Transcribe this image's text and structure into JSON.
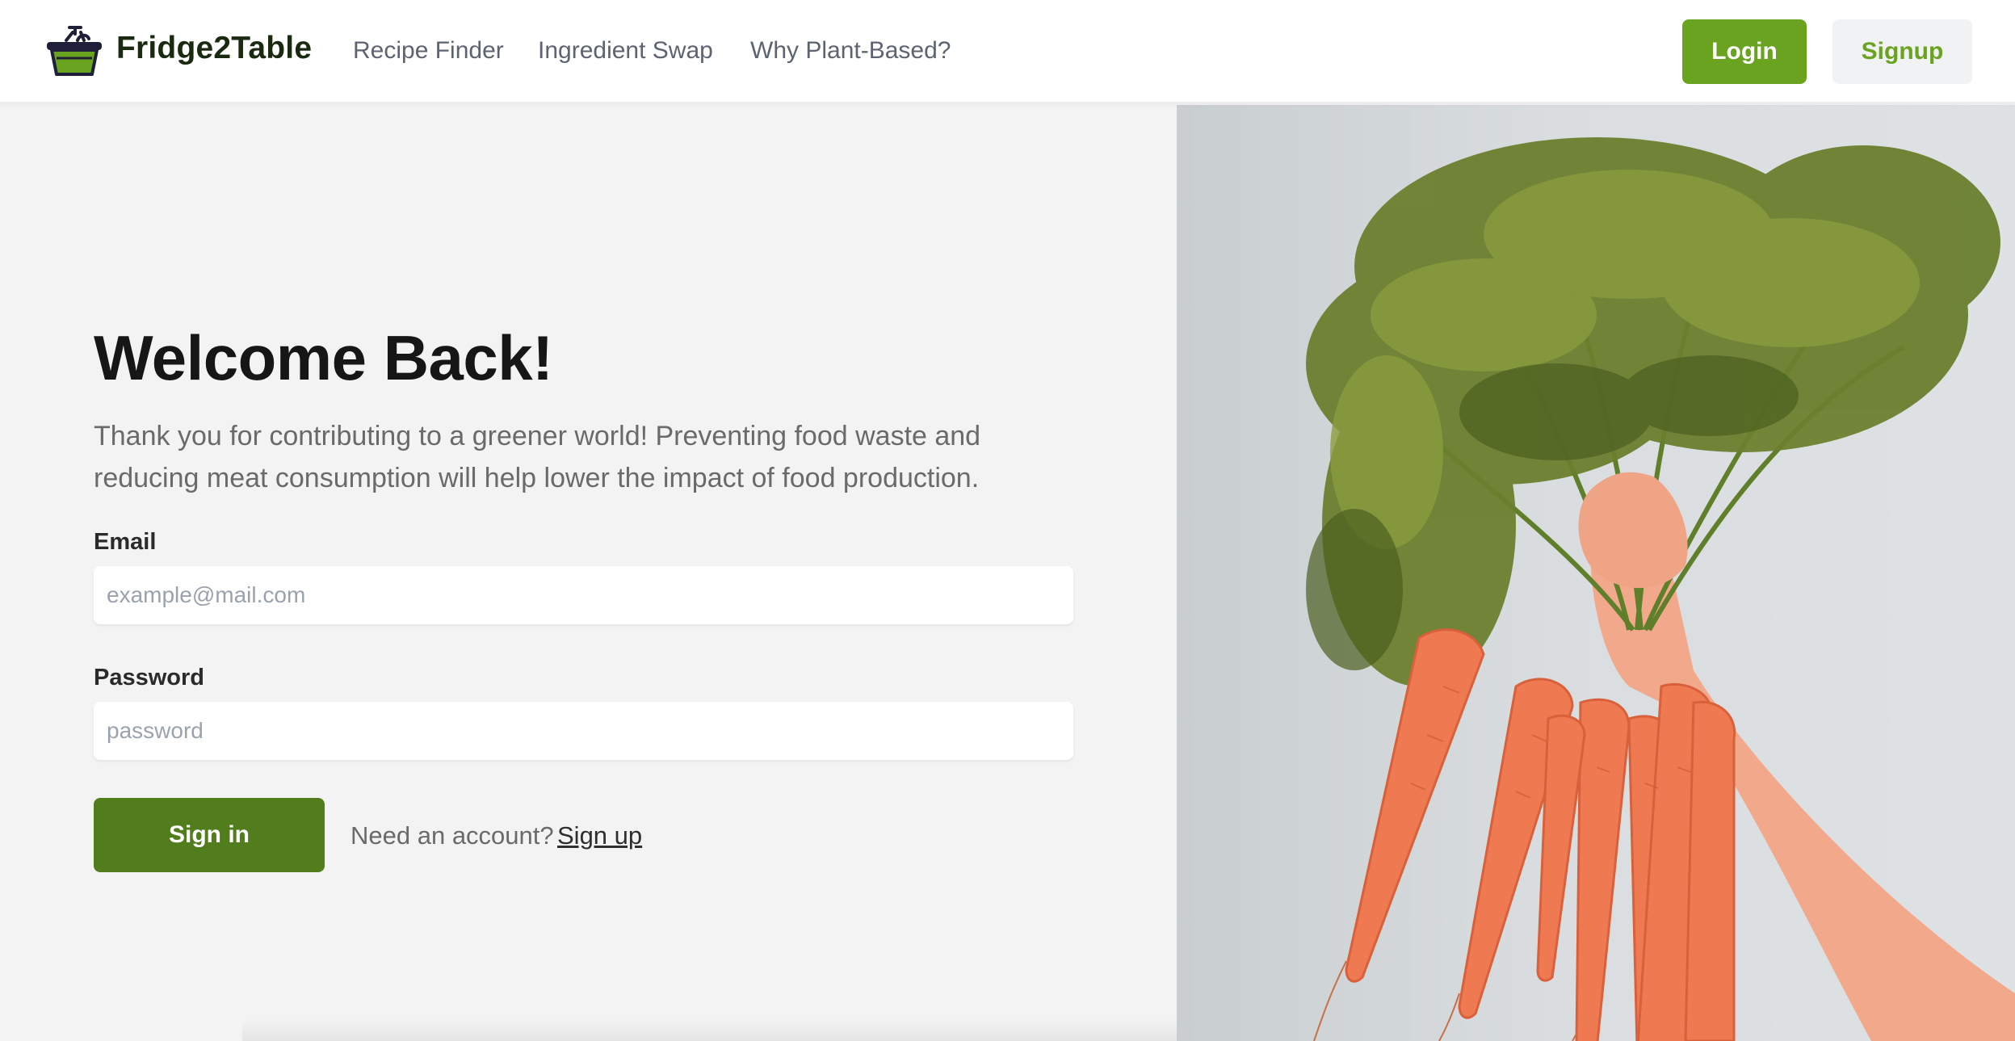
{
  "header": {
    "brand": "Fridge2Table",
    "logo_icon": "basket-icon",
    "nav": [
      {
        "label": "Recipe Finder"
      },
      {
        "label": "Ingredient Swap"
      },
      {
        "label": "Why Plant-Based?"
      }
    ],
    "login_label": "Login",
    "signup_label": "Signup"
  },
  "main": {
    "title": "Welcome Back!",
    "subtitle": "Thank you for contributing to a greener world! Preventing food waste and reducing meat consumption will help lower the impact of food production.",
    "email_label": "Email",
    "email_placeholder": "example@mail.com",
    "email_value": "",
    "password_label": "Password",
    "password_placeholder": "password",
    "password_value": "",
    "signin_label": "Sign in",
    "need_account_text": "Need an account?",
    "signup_link_label": "Sign up"
  },
  "hero": {
    "image": "hand-holding-carrots-image"
  },
  "colors": {
    "brand_green": "#6aa320",
    "signin_green": "#527d1c",
    "page_bg": "#f3f3f3"
  }
}
